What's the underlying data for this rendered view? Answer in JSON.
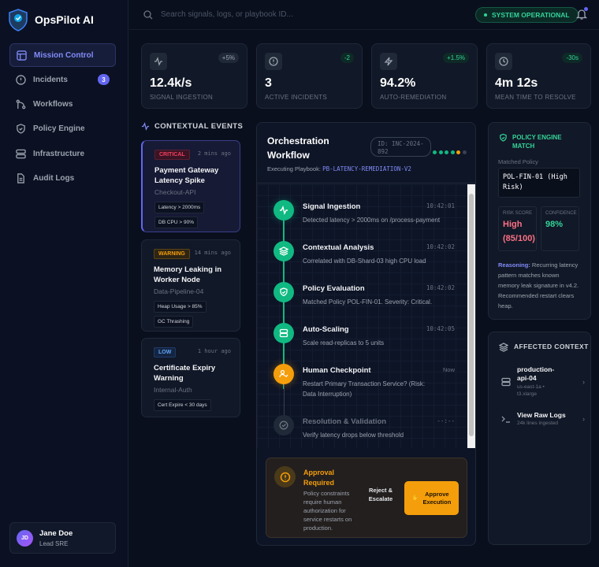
{
  "app": {
    "name": "OpsPilot AI"
  },
  "sidebar": {
    "items": [
      {
        "label": "Mission Control",
        "icon": "layout-icon",
        "active": true
      },
      {
        "label": "Incidents",
        "icon": "alert-circle-icon",
        "badge": "3"
      },
      {
        "label": "Workflows",
        "icon": "git-branch-icon"
      },
      {
        "label": "Policy Engine",
        "icon": "shield-icon"
      },
      {
        "label": "Infrastructure",
        "icon": "server-icon"
      },
      {
        "label": "Audit Logs",
        "icon": "file-text-icon"
      }
    ],
    "user": {
      "initials": "JD",
      "name": "Jane Doe",
      "role": "Lead SRE"
    }
  },
  "header": {
    "search_placeholder": "Search signals, logs, or playbook ID...",
    "status": "SYSTEM OPERATIONAL",
    "notification_dot": true
  },
  "stats": [
    {
      "value": "12.4k/s",
      "label": "SIGNAL INGESTION",
      "change": "+5%",
      "icon": "activity-icon"
    },
    {
      "value": "3",
      "label": "ACTIVE INCIDENTS",
      "change": "-2",
      "icon": "alert-circle-icon"
    },
    {
      "value": "94.2%",
      "label": "AUTO-REMEDIATION",
      "change": "+1.5%",
      "icon": "zap-icon"
    },
    {
      "value": "4m 12s",
      "label": "MEAN TIME TO RESOLVE",
      "change": "-30s",
      "icon": "clock-icon"
    }
  ],
  "events": {
    "title": "CONTEXTUAL EVENTS",
    "items": [
      {
        "severity": "CRITICAL",
        "time": "2 mins ago",
        "title": "Payment Gateway Latency Spike",
        "source": "Checkout-API",
        "chips": [
          "Latency > 2000ms",
          "DB CPU > 90%"
        ]
      },
      {
        "severity": "WARNING",
        "time": "14 mins ago",
        "title": "Memory Leaking in Worker Node",
        "source": "Data-Pipeline-04",
        "chips": [
          "Heap Usage > 85%",
          "GC Thrashing"
        ]
      },
      {
        "severity": "LOW",
        "time": "1 hour ago",
        "title": "Certificate Expiry Warning",
        "source": "Internal-Auth",
        "chips": [
          "Cert Expire < 30 days"
        ]
      }
    ]
  },
  "workflow": {
    "title": "Orchestration Workflow",
    "id": "ID: INC-2024-892",
    "playbook_label": "Executing Playbook:",
    "playbook": "PB-LATENCY-REMEDIATION-V2",
    "progress_completed": 4,
    "progress_current": 1,
    "progress_total": 6,
    "steps": [
      {
        "title": "Signal Ingestion",
        "desc": "Detected latency > 2000ms on /process-payment",
        "time": "10:42:01",
        "state": "done",
        "icon": "activity-icon"
      },
      {
        "title": "Contextual Analysis",
        "desc": "Correlated with DB-Shard-03 high CPU load",
        "time": "10:42:02",
        "state": "done",
        "icon": "layers-icon"
      },
      {
        "title": "Policy Evaluation",
        "desc": "Matched Policy POL-FIN-01. Severity: Critical.",
        "time": "10:42:02",
        "state": "done",
        "icon": "shield-check-icon"
      },
      {
        "title": "Auto-Scaling",
        "desc": "Scale read-replicas to 5 units",
        "time": "10:42:05",
        "state": "done",
        "icon": "server-icon"
      },
      {
        "title": "Human Checkpoint",
        "desc": "Restart Primary Transaction Service? (Risk: Data Interruption)",
        "time": "Now",
        "state": "current",
        "icon": "user-check-icon"
      },
      {
        "title": "Resolution & Validation",
        "desc": "Verify latency drops below threshold",
        "time": "--:--",
        "state": "pending",
        "icon": "check-circle-icon"
      }
    ],
    "approval": {
      "title": "Approval Required",
      "desc": "Policy constraints require human authorization for service restarts on production.",
      "reject": "Reject & Escalate",
      "approve": "Approve Execution"
    }
  },
  "policy": {
    "title": "POLICY ENGINE MATCH",
    "matched_label": "Matched Policy",
    "matched": "POL-FIN-01 (High Risk)",
    "risk_label": "RISK SCORE",
    "risk": "High (85/100)",
    "conf_label": "CONFIDENCE",
    "conf": "98%",
    "reason_label": "Reasoning:",
    "reason": " Recurring latency pattern matches known memory leak signature in v4.2. Recommended restart clears heap."
  },
  "context": {
    "title": "AFFECTED CONTEXT",
    "items": [
      {
        "title": "production-api-04",
        "sub": "us-east-1a • t3.xlarge",
        "icon": "server-icon"
      },
      {
        "title": "View Raw Logs",
        "sub": "24k lines ingested",
        "icon": "terminal-icon"
      }
    ]
  },
  "colors": {
    "accent": "#6366f1",
    "success": "#10b981",
    "warning": "#f59e0b",
    "critical": "#f43f5e"
  }
}
